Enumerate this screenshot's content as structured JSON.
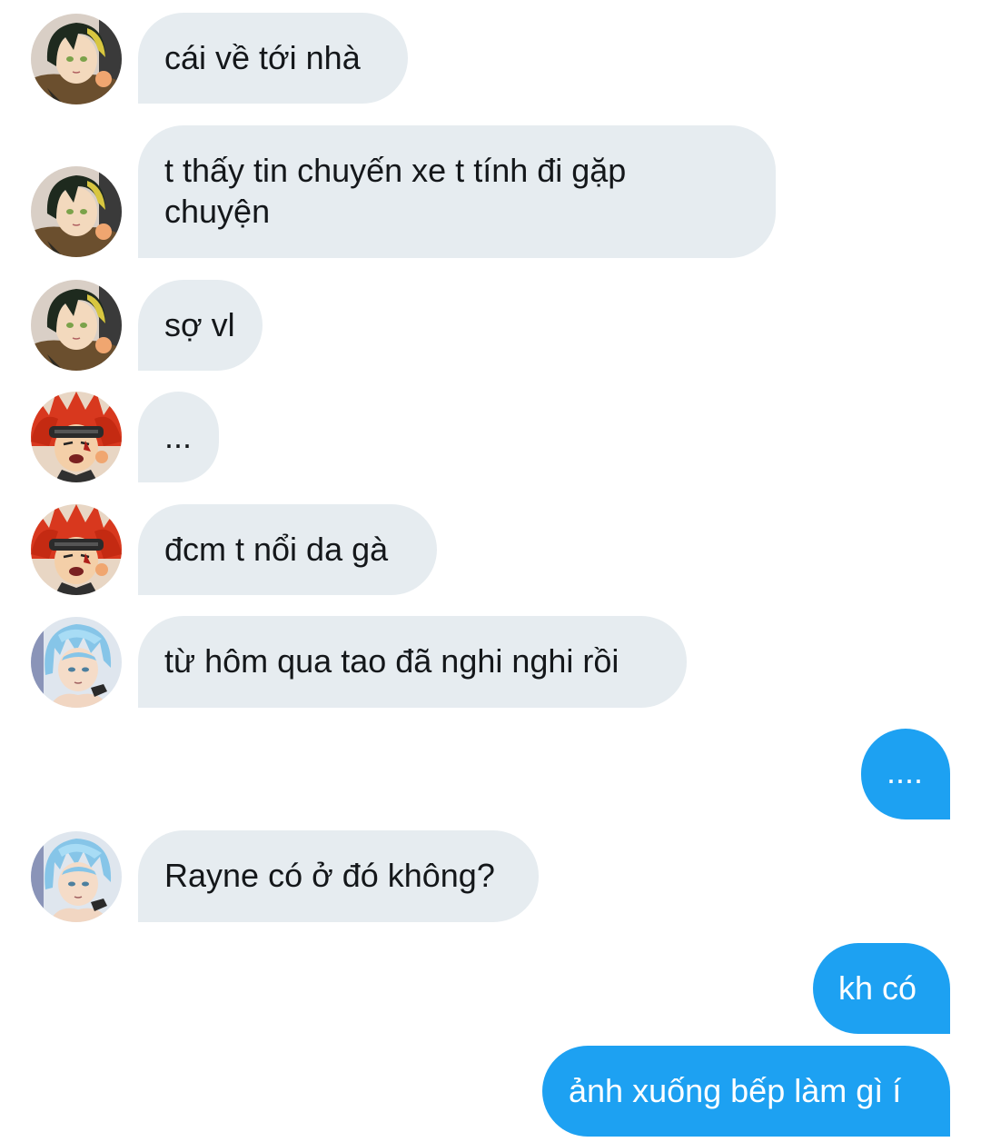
{
  "colors": {
    "incoming_bubble": "#e6ecf0",
    "outgoing_bubble": "#1da1f2",
    "incoming_text": "#14171a",
    "outgoing_text": "#ffffff"
  },
  "messages": [
    {
      "direction": "incoming",
      "sender_avatar": "green-hair-avatar",
      "text": "cái về tới nhà"
    },
    {
      "direction": "incoming",
      "sender_avatar": "green-hair-avatar",
      "text": "t thấy tin chuyến xe t tính đi gặp chuyện"
    },
    {
      "direction": "incoming",
      "sender_avatar": "green-hair-avatar",
      "text": "sợ vl"
    },
    {
      "direction": "incoming",
      "sender_avatar": "red-hair-avatar",
      "text": "..."
    },
    {
      "direction": "incoming",
      "sender_avatar": "red-hair-avatar",
      "text": "đcm t nổi da gà"
    },
    {
      "direction": "incoming",
      "sender_avatar": "blue-hair-avatar",
      "text": "từ hôm qua tao đã nghi nghi rồi"
    },
    {
      "direction": "outgoing",
      "text": "...."
    },
    {
      "direction": "incoming",
      "sender_avatar": "blue-hair-avatar",
      "text": "Rayne có ở đó không?"
    },
    {
      "direction": "outgoing",
      "text": "kh có"
    },
    {
      "direction": "outgoing",
      "text": "ảnh xuống bếp làm gì í"
    }
  ]
}
